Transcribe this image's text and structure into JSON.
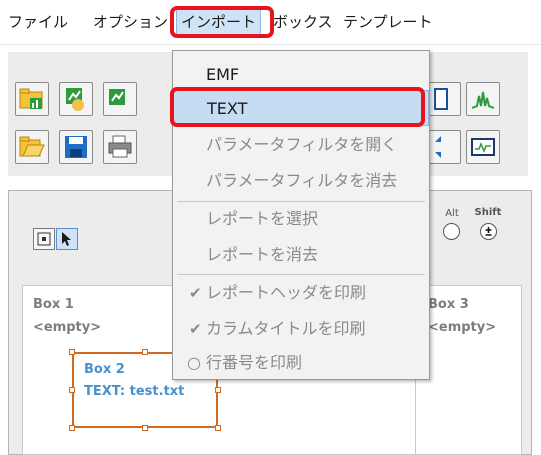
{
  "menubar": {
    "items": [
      {
        "label": "ファイル"
      },
      {
        "label": "オプション"
      },
      {
        "label": "インポート"
      },
      {
        "label": "ボックス"
      },
      {
        "label": "テンプレート"
      }
    ]
  },
  "import_menu": {
    "items": [
      {
        "label": "EMF",
        "enabled": true
      },
      {
        "label": "TEXT",
        "enabled": true,
        "highlighted": true
      },
      {
        "label": "パラメータフィルタを開く",
        "enabled": false
      },
      {
        "label": "パラメータフィルタを消去",
        "enabled": false
      },
      {
        "label": "レポートを選択",
        "enabled": false
      },
      {
        "label": "レポートを消去",
        "enabled": false
      },
      {
        "label": "レポートヘッダを印刷",
        "enabled": false,
        "marker": "checked"
      },
      {
        "label": "カラムタイトルを印刷",
        "enabled": false,
        "marker": "checked"
      },
      {
        "label": "行番号を印刷",
        "enabled": false,
        "marker": "radio-empty"
      }
    ]
  },
  "modifiers": {
    "alt_label": "Alt",
    "shift_label": "Shift"
  },
  "boxes": [
    {
      "title": "Box 1",
      "content": "<empty>"
    },
    {
      "title": "Box 2",
      "content": "TEXT: test.txt"
    },
    {
      "title": "Box 3",
      "content": "<empty>"
    }
  ],
  "colors": {
    "highlight_outline": "#e8141b",
    "menu_hover": "#c6dcf2",
    "selected_box_border": "#d2691e",
    "box2_text": "#4a8fd0"
  }
}
